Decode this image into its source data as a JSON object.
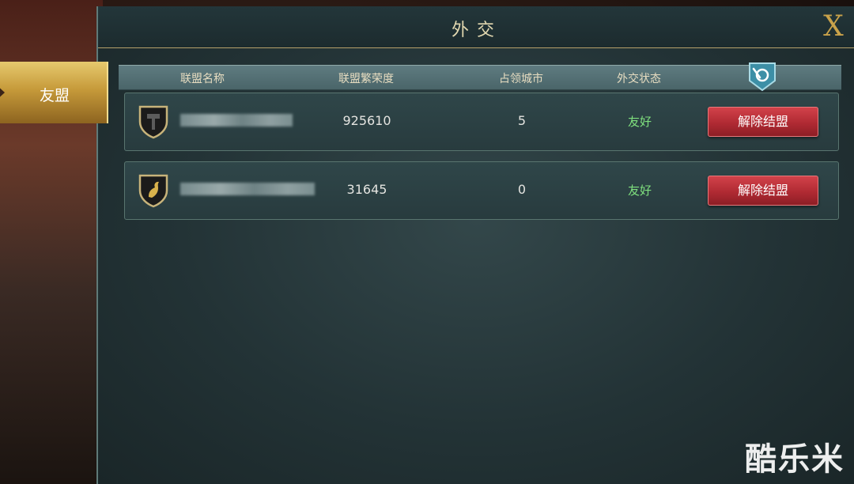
{
  "window": {
    "title": "外交",
    "close_label": "X"
  },
  "sidebar": {
    "tabs": [
      {
        "label": "友盟",
        "active": true
      }
    ]
  },
  "table": {
    "columns": [
      "联盟名称",
      "联盟繁荣度",
      "占领城市",
      "外交状态"
    ],
    "rows": [
      {
        "alliance_name_obscured": true,
        "prosperity": "925610",
        "cities": "5",
        "status": "友好",
        "action": "解除结盟"
      },
      {
        "alliance_name_obscured": true,
        "prosperity": "31645",
        "cities": "0",
        "status": "友好",
        "action": "解除结盟"
      }
    ]
  },
  "watermark": "酷乐米",
  "colors": {
    "accent_gold": "#c9a24a",
    "status_green": "#7fe07e",
    "button_red": "#c0353d",
    "panel": "#233336"
  }
}
